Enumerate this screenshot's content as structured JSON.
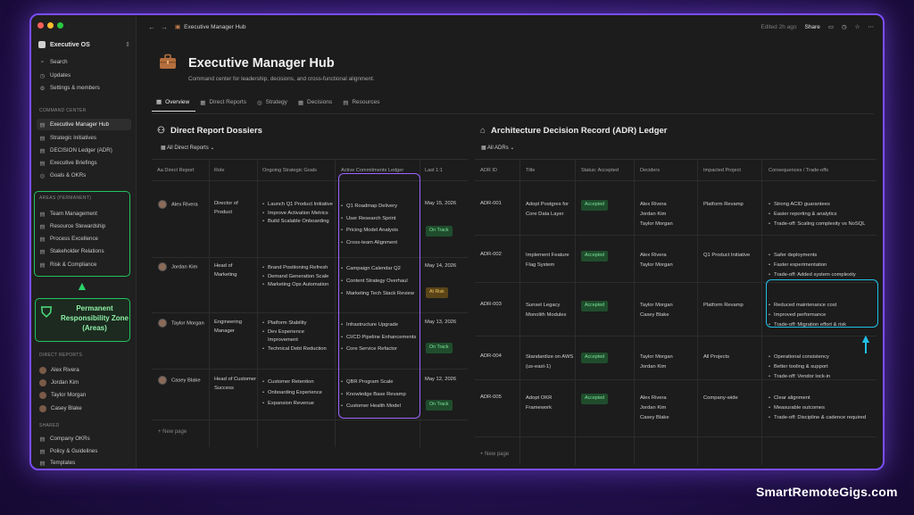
{
  "window": {
    "traffic_colors": [
      "#ff5f57",
      "#febc2e",
      "#28c840"
    ]
  },
  "sidebar": {
    "workspace": "Executive OS",
    "top_items": [
      {
        "icon": "search-icon",
        "label": "Search"
      },
      {
        "icon": "clock-icon",
        "label": "Updates"
      },
      {
        "icon": "gear-icon",
        "label": "Settings & members"
      }
    ],
    "command_center": {
      "header": "COMMAND CENTER",
      "items": [
        "Executive Manager Hub",
        "Strategic Initiatives",
        "DECISION Ledger (ADR)",
        "Executive Briefings",
        "Goals & OKRs"
      ]
    },
    "areas": {
      "header": "AREAS (PERMANENT)",
      "items": [
        "Team Management",
        "Resource Stewardship",
        "Process Excellence",
        "Stakeholder Relations",
        "Risk & Compliance"
      ]
    },
    "callout": "Permanent Responsibility Zone (Areas)",
    "direct_reports": {
      "header": "DIRECT REPORTS",
      "items": [
        "Alex Rivera",
        "Jordan Kim",
        "Taylor Morgan",
        "Casey Blake"
      ]
    },
    "shared": {
      "header": "SHARED",
      "items": [
        "Company OKRs",
        "Policy & Guidelines",
        "Templates"
      ]
    }
  },
  "topbar": {
    "breadcrumb": "Executive Manager Hub",
    "edited": "Edited 2h ago",
    "share": "Share"
  },
  "page": {
    "title": "Executive Manager Hub",
    "subtitle": "Command center for leadership, decisions, and cross-functional alignment.",
    "tabs": [
      "Overview",
      "Direct Reports",
      "Strategy",
      "Decisions",
      "Resources"
    ]
  },
  "dossiers": {
    "title": "Direct Report Dossiers",
    "view": "All Direct Reports",
    "columns": [
      "Direct Report",
      "Role",
      "Ongoing Strategic Goals",
      "Active Commitments Ledger",
      "Last 1:1"
    ],
    "rows": [
      {
        "name": "Alex Rivera",
        "role": "Director of Product",
        "goals": [
          "Launch Q1 Product Initiative",
          "Improve Activation Metrics",
          "Build Scalable Onboarding"
        ],
        "commitments": [
          "Q1 Roadmap Delivery",
          "User Research Sprint",
          "Pricing Model Analysis",
          "Cross-team Alignment"
        ],
        "last": "May 15, 2026",
        "status": "On Track"
      },
      {
        "name": "Jordan Kim",
        "role": "Head of Marketing",
        "goals": [
          "Brand Positioning Refresh",
          "Demand Generation Scale",
          "Marketing Ops Automation"
        ],
        "commitments": [
          "Campaign Calendar Q2",
          "Content Strategy Overhaul",
          "Marketing Tech Stack Review"
        ],
        "last": "May 14, 2026",
        "status": "At Risk"
      },
      {
        "name": "Taylor Morgan",
        "role": "Engineering Manager",
        "goals": [
          "Platform Stability",
          "Dev Experience Improvement",
          "Technical Debt Reduction"
        ],
        "commitments": [
          "Infrastructure Upgrade",
          "CI/CD Pipeline Enhancements",
          "Core Service Refactor"
        ],
        "last": "May 13, 2026",
        "status": "On Track"
      },
      {
        "name": "Casey Blake",
        "role": "Head of Customer Success",
        "goals": [
          "Customer Retention",
          "Onboarding Experience",
          "Expansion Revenue"
        ],
        "commitments": [
          "QBR Program Scale",
          "Knowledge Base Revamp",
          "Customer Health Model"
        ],
        "last": "May 12, 2026",
        "status": "On Track"
      }
    ],
    "new_page": "New page"
  },
  "adr": {
    "title": "Architecture Decision Record (ADR) Ledger",
    "view": "All ADRs",
    "columns": [
      "ADR ID",
      "Title",
      "Status: Accepted",
      "Deciders",
      "Impacted Project",
      "Consequences / Trade-offs"
    ],
    "rows": [
      {
        "id": "ADR-001",
        "title": "Adopt Postgres for Core Data Layer",
        "status": "Accepted",
        "deciders": [
          "Alex Rivera",
          "Jordan Kim",
          "Taylor Morgan"
        ],
        "project": "Platform Revamp",
        "consequences": [
          "Strong ACID guarantees",
          "Easier reporting & analytics",
          "Trade-off: Scaling complexity vs NoSQL"
        ]
      },
      {
        "id": "ADR-002",
        "title": "Implement Feature Flag System",
        "status": "Accepted",
        "deciders": [
          "Alex Rivera",
          "Taylor Morgan"
        ],
        "project": "Q1 Product Initiative",
        "consequences": [
          "Safer deployments",
          "Faster experimentation",
          "Trade-off: Added system complexity"
        ]
      },
      {
        "id": "ADR-003",
        "title": "Sunset Legacy Monolith Modules",
        "status": "Accepted",
        "deciders": [
          "Taylor Morgan",
          "Casey Blake"
        ],
        "project": "Platform Revamp",
        "consequences": [
          "Reduced maintenance cost",
          "Improved performance",
          "Trade-off: Migration effort & risk"
        ]
      },
      {
        "id": "ADR-004",
        "title": "Standardize on AWS (us-east-1)",
        "status": "Accepted",
        "deciders": [
          "Taylor Morgan",
          "Jordan Kim"
        ],
        "project": "All Projects",
        "consequences": [
          "Operational consistency",
          "Better tooling & support",
          "Trade-off: Vendor lock-in"
        ]
      },
      {
        "id": "ADR-005",
        "title": "Adopt OKR Framework",
        "status": "Accepted",
        "deciders": [
          "Alex Rivera",
          "Jordan Kim",
          "Casey Blake"
        ],
        "project": "Company-wide",
        "consequences": [
          "Clear alignment",
          "Measurable outcomes",
          "Trade-off: Discipline & cadence required"
        ]
      }
    ],
    "new_page": "New page"
  },
  "watermark": "SmartRemoteGigs.com",
  "colors": {
    "accent_green": "#22c35e",
    "accent_purple": "#a063ff",
    "accent_cyan": "#22c0e6"
  }
}
